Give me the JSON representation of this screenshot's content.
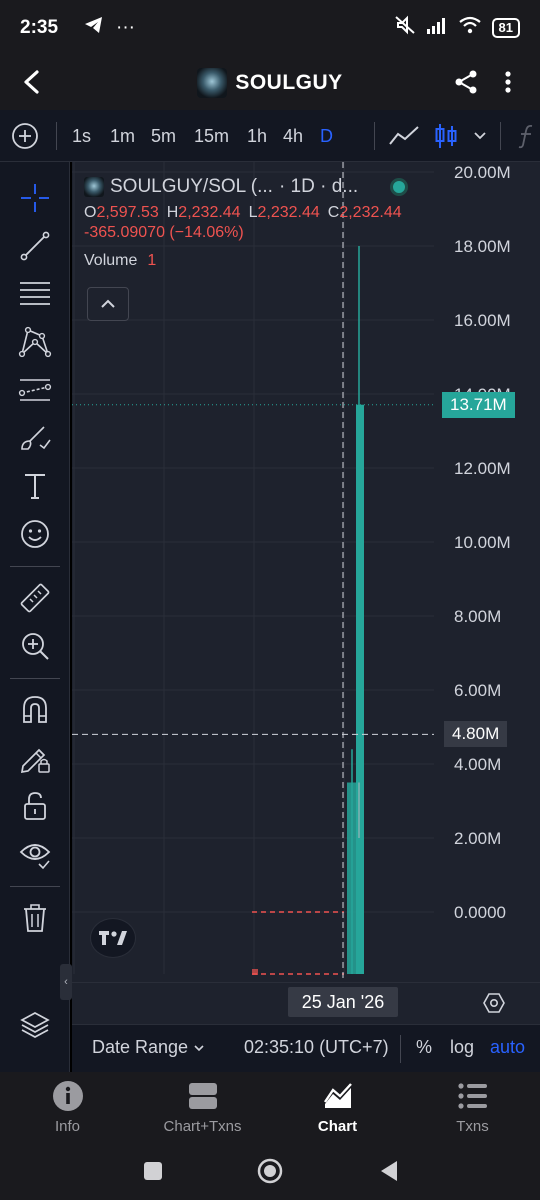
{
  "status": {
    "time": "2:35",
    "battery": "81",
    "more": "···"
  },
  "header": {
    "title": "SOULGUY"
  },
  "timeframes": {
    "items": [
      "1s",
      "1m",
      "5m",
      "15m",
      "1h",
      "4h",
      "D"
    ],
    "active": "D"
  },
  "legend": {
    "symbol": "SOULGUY/SOL (...",
    "interval": "· 1D · d...",
    "o_label": "O",
    "o": "2,597.53",
    "h_label": "H",
    "h": "2,232.44",
    "l_label": "L",
    "l": "2,232.44",
    "c_label": "C",
    "c": "2,232.44",
    "change": "-365.09070 (−14.06%)",
    "volume_label": "Volume",
    "volume_value": "1"
  },
  "price_axis": {
    "labels": [
      "20.00M",
      "18.00M",
      "16.00M",
      "14.00M",
      "12.00M",
      "10.00M",
      "8.00M",
      "6.00M",
      "4.00M",
      "2.00M",
      "0.0000"
    ],
    "last_price": "13.71M",
    "crosshair_price": "4.80M"
  },
  "date_axis": {
    "crosshair_date": "25 Jan '26"
  },
  "bottom_toolbar": {
    "date_range": "Date Range",
    "clock": "02:35:10 (UTC+7)",
    "percent": "%",
    "log": "log",
    "auto": "auto"
  },
  "app_nav": {
    "items": [
      "Info",
      "Chart+Txns",
      "Chart",
      "Txns"
    ],
    "active": "Chart"
  },
  "colors": {
    "up": "#26a69a",
    "down": "#ef5350",
    "accent": "#2962ff",
    "chart_bg": "#1e222d"
  },
  "chart_data": {
    "type": "bar",
    "price_axis_range": [
      0,
      20000000
    ],
    "last_value": 13710000,
    "crosshair_value": 4800000,
    "crosshair_date": "25 Jan '26",
    "candles": [
      {
        "open": 3500000,
        "close": 13710000,
        "high": 18000000,
        "low": 3500000,
        "direction": "up"
      },
      {
        "open": 0,
        "close": 3500000,
        "high": 4400000,
        "low": 0,
        "direction": "up"
      }
    ]
  }
}
